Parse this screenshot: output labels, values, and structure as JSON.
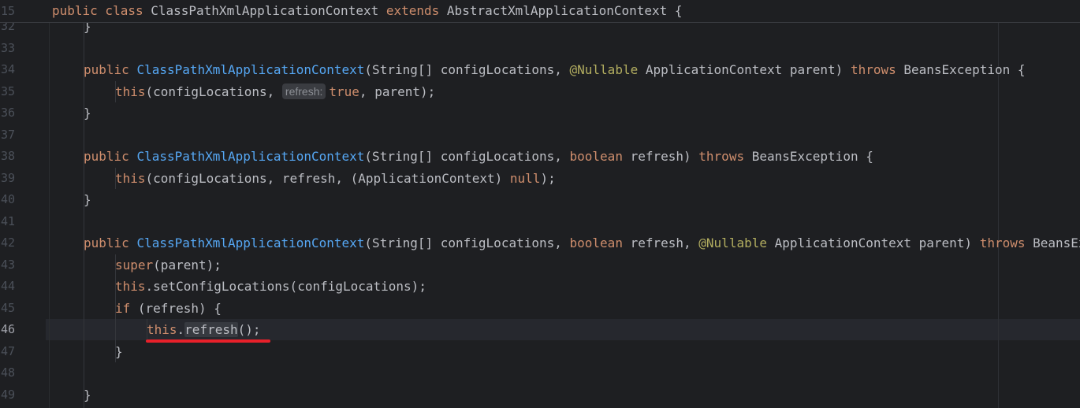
{
  "sticky": {
    "line_number": "15",
    "tokens": [
      {
        "t": "public class ",
        "c": "kw"
      },
      {
        "t": "ClassPathXmlApplicationContext ",
        "c": "pl"
      },
      {
        "t": "extends ",
        "c": "kw"
      },
      {
        "t": "AbstractXmlApplicationContext {",
        "c": "pl"
      }
    ]
  },
  "lines": [
    {
      "n": "32",
      "indent": 1,
      "tokens": [
        {
          "t": "}",
          "c": "pl"
        }
      ]
    },
    {
      "n": "33",
      "indent": 0,
      "tokens": []
    },
    {
      "n": "34",
      "indent": 1,
      "tokens": [
        {
          "t": "public ",
          "c": "kw"
        },
        {
          "t": "ClassPathXmlApplicationContext",
          "c": "fn"
        },
        {
          "t": "(String[] configLocations, ",
          "c": "pl"
        },
        {
          "t": "@Nullable ",
          "c": "an"
        },
        {
          "t": "ApplicationContext parent) ",
          "c": "pl"
        },
        {
          "t": "throws ",
          "c": "kw"
        },
        {
          "t": "BeansException {",
          "c": "pl"
        }
      ]
    },
    {
      "n": "35",
      "indent": 2,
      "tokens": [
        {
          "t": "this",
          "c": "kw"
        },
        {
          "t": "(configLocations, ",
          "c": "pl"
        },
        {
          "t": "refresh:",
          "c": "hint"
        },
        {
          "t": "true",
          "c": "kw"
        },
        {
          "t": ", parent);",
          "c": "pl"
        }
      ]
    },
    {
      "n": "36",
      "indent": 1,
      "tokens": [
        {
          "t": "}",
          "c": "pl"
        }
      ]
    },
    {
      "n": "37",
      "indent": 0,
      "tokens": []
    },
    {
      "n": "38",
      "indent": 1,
      "tokens": [
        {
          "t": "public ",
          "c": "kw"
        },
        {
          "t": "ClassPathXmlApplicationContext",
          "c": "fn"
        },
        {
          "t": "(String[] configLocations, ",
          "c": "pl"
        },
        {
          "t": "boolean ",
          "c": "kw"
        },
        {
          "t": "refresh) ",
          "c": "pl"
        },
        {
          "t": "throws ",
          "c": "kw"
        },
        {
          "t": "BeansException {",
          "c": "pl"
        }
      ]
    },
    {
      "n": "39",
      "indent": 2,
      "tokens": [
        {
          "t": "this",
          "c": "kw"
        },
        {
          "t": "(configLocations, refresh, (ApplicationContext) ",
          "c": "pl"
        },
        {
          "t": "null",
          "c": "kw"
        },
        {
          "t": ");",
          "c": "pl"
        }
      ]
    },
    {
      "n": "40",
      "indent": 1,
      "tokens": [
        {
          "t": "}",
          "c": "pl"
        }
      ]
    },
    {
      "n": "41",
      "indent": 0,
      "tokens": []
    },
    {
      "n": "42",
      "indent": 1,
      "tokens": [
        {
          "t": "public ",
          "c": "kw"
        },
        {
          "t": "ClassPathXmlApplicationContext",
          "c": "fn"
        },
        {
          "t": "(String[] configLocations, ",
          "c": "pl"
        },
        {
          "t": "boolean ",
          "c": "kw"
        },
        {
          "t": "refresh, ",
          "c": "pl"
        },
        {
          "t": "@Nullable ",
          "c": "an"
        },
        {
          "t": "ApplicationContext parent) ",
          "c": "pl"
        },
        {
          "t": "throws ",
          "c": "kw"
        },
        {
          "t": "BeansException {",
          "c": "pl"
        }
      ]
    },
    {
      "n": "43",
      "indent": 2,
      "tokens": [
        {
          "t": "super",
          "c": "kw"
        },
        {
          "t": "(parent);",
          "c": "pl"
        }
      ]
    },
    {
      "n": "44",
      "indent": 2,
      "tokens": [
        {
          "t": "this",
          "c": "kw"
        },
        {
          "t": ".setConfigLocations(configLocations);",
          "c": "pl"
        }
      ]
    },
    {
      "n": "45",
      "indent": 2,
      "tokens": [
        {
          "t": "if ",
          "c": "kw"
        },
        {
          "t": "(refresh) {",
          "c": "pl"
        }
      ]
    },
    {
      "n": "46",
      "indent": 3,
      "current": true,
      "tokens": [
        {
          "t": "this",
          "c": "kw"
        },
        {
          "t": ".",
          "c": "pl"
        },
        {
          "t": "refresh",
          "c": "ref"
        },
        {
          "t": "();",
          "c": "pl"
        }
      ]
    },
    {
      "n": "47",
      "indent": 2,
      "tokens": [
        {
          "t": "}",
          "c": "pl"
        }
      ]
    },
    {
      "n": "48",
      "indent": 0,
      "tokens": []
    },
    {
      "n": "49",
      "indent": 1,
      "tokens": [
        {
          "t": "}",
          "c": "pl"
        }
      ]
    }
  ],
  "colors": {
    "background": "#1e1f22",
    "keyword": "#cf8e6d",
    "method": "#56a8f5",
    "annotation": "#b3ae60",
    "plain": "#bcbec4",
    "current_line": "#26282e",
    "red_underline": "#e8202a"
  }
}
